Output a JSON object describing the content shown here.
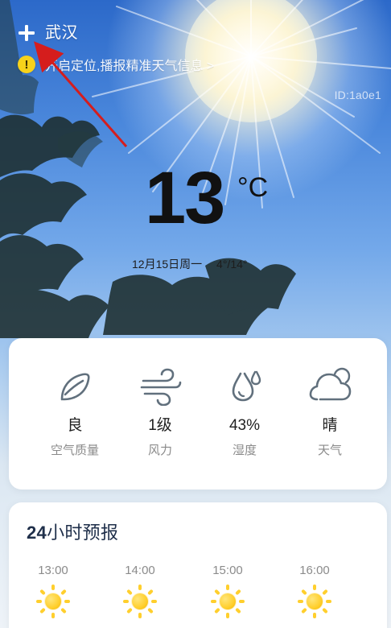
{
  "header": {
    "city": "武汉",
    "location_tip": "开启定位,播报精准天气信息 >",
    "watermark": "ID:1a0e1"
  },
  "current": {
    "temperature": "13",
    "unit": "°C",
    "date": "12月15日周一",
    "range": "4°/14°"
  },
  "metrics": [
    {
      "icon": "leaf-icon",
      "value": "良",
      "label": "空气质量"
    },
    {
      "icon": "wind-icon",
      "value": "1级",
      "label": "风力"
    },
    {
      "icon": "humidity-icon",
      "value": "43%",
      "label": "湿度"
    },
    {
      "icon": "partly-sunny-icon",
      "value": "晴",
      "label": "天气"
    }
  ],
  "forecast": {
    "title_num": "24",
    "title_text": "小时预报",
    "hours": [
      {
        "time": "13:00",
        "icon": "sun-icon"
      },
      {
        "time": "14:00",
        "icon": "sun-icon"
      },
      {
        "time": "15:00",
        "icon": "sun-icon"
      },
      {
        "time": "16:00",
        "icon": "sun-icon"
      }
    ]
  }
}
